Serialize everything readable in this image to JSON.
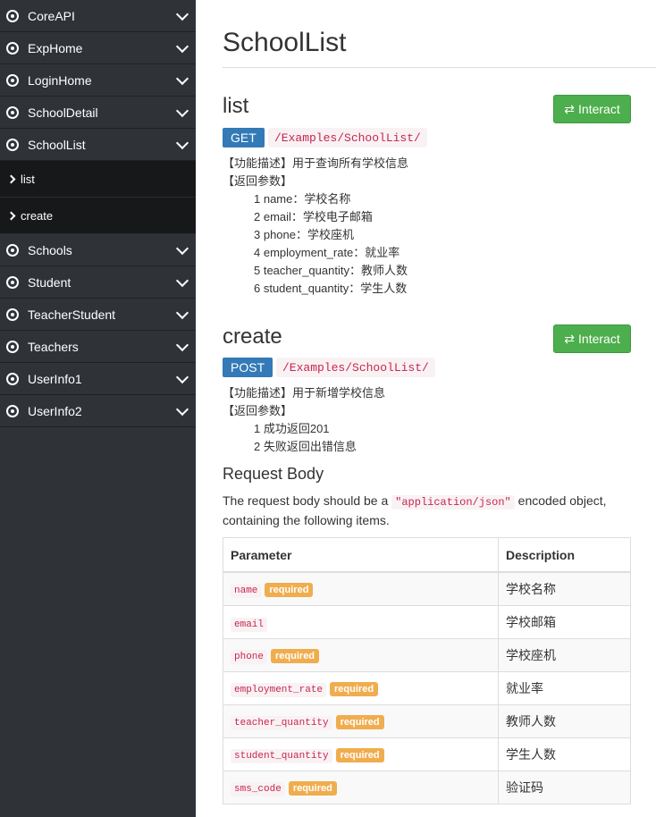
{
  "sidebar": {
    "items_top": [
      {
        "label": "CoreAPI"
      },
      {
        "label": "ExpHome"
      },
      {
        "label": "LoginHome"
      },
      {
        "label": "SchoolDetail"
      },
      {
        "label": "SchoolList"
      }
    ],
    "sub_items": [
      {
        "label": "list"
      },
      {
        "label": "create"
      }
    ],
    "items_bottom": [
      {
        "label": "Schools"
      },
      {
        "label": "Student"
      },
      {
        "label": "TeacherStudent"
      },
      {
        "label": "Teachers"
      },
      {
        "label": "UserInfo1"
      },
      {
        "label": "UserInfo2"
      }
    ]
  },
  "page": {
    "title": "SchoolList"
  },
  "endpoints": [
    {
      "title": "list",
      "method": "GET",
      "path": "/Examples/SchoolList/",
      "interact_label": "Interact",
      "desc_lines": [
        "【功能描述】用于查询所有学校信息",
        "【返回参数】"
      ],
      "params": [
        "1 name：学校名称",
        "2 email：学校电子邮箱",
        "3 phone：学校座机",
        "4 employment_rate：就业率",
        "5 teacher_quantity：教师人数",
        "6 student_quantity：学生人数"
      ]
    },
    {
      "title": "create",
      "method": "POST",
      "path": "/Examples/SchoolList/",
      "interact_label": "Interact",
      "desc_lines": [
        "【功能描述】用于新增学校信息",
        "【返回参数】"
      ],
      "params": [
        "1 成功返回201",
        "2 失败返回出错信息"
      ]
    }
  ],
  "request_body": {
    "title": "Request Body",
    "text_before": "The request body should be a ",
    "code": "\"application/json\"",
    "text_after": " encoded object, containing the following items.",
    "columns": [
      "Parameter",
      "Description"
    ],
    "required_label": "required",
    "rows": [
      {
        "param": "name",
        "required": true,
        "desc": "学校名称"
      },
      {
        "param": "email",
        "required": false,
        "desc": "学校邮箱"
      },
      {
        "param": "phone",
        "required": true,
        "desc": "学校座机"
      },
      {
        "param": "employment_rate",
        "required": true,
        "desc": "就业率"
      },
      {
        "param": "teacher_quantity",
        "required": true,
        "desc": "教师人数"
      },
      {
        "param": "student_quantity",
        "required": true,
        "desc": "学生人数"
      },
      {
        "param": "sms_code",
        "required": true,
        "desc": "验证码"
      }
    ]
  },
  "colors": {
    "sidebar_bg": "#2f3338",
    "interact_button": "#4cae4c",
    "get_badge": "#337ab7",
    "required_badge": "#f0ad4e",
    "code_text": "#c7254e"
  }
}
